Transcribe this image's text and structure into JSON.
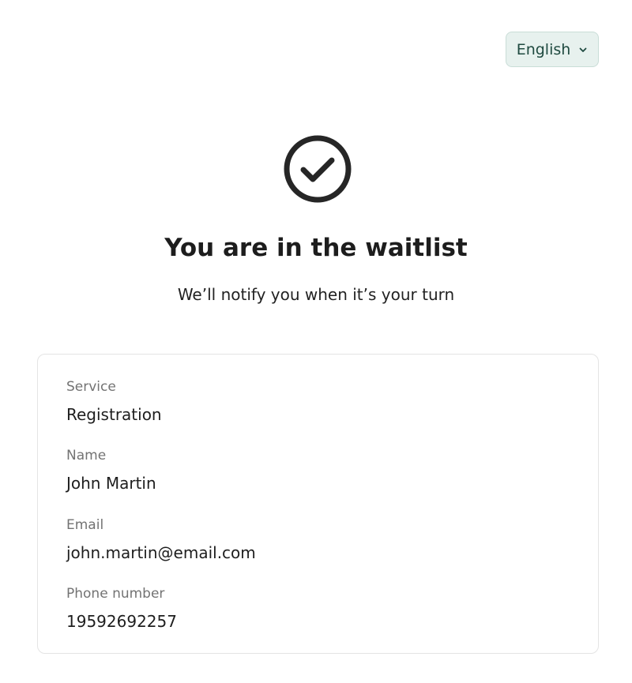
{
  "language": {
    "selected": "English",
    "icon": "chevron-down-icon"
  },
  "status": {
    "icon": "check-circle-icon",
    "title": "You are in the waitlist",
    "subtitle": "We’ll notify you when it’s your turn"
  },
  "details": {
    "service_label": "Service",
    "service_value": "Registration",
    "name_label": "Name",
    "name_value": "John Martin",
    "email_label": "Email",
    "email_value": "john.martin@email.com",
    "phone_label": "Phone number",
    "phone_value": "19592692257"
  },
  "colors": {
    "accent_bg": "#e7f1ee",
    "accent_text": "#1f4a40",
    "check_stroke": "#262626"
  }
}
